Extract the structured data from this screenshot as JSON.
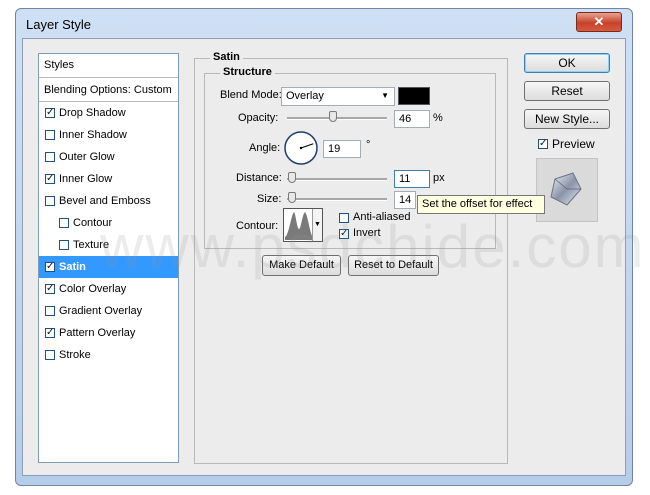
{
  "window": {
    "title": "Layer Style",
    "close_glyph": "✕"
  },
  "styles_panel": {
    "items": [
      {
        "label": "Styles",
        "checkbox": false,
        "checked": false
      },
      {
        "label": "Blending Options: Custom",
        "checkbox": false,
        "checked": false
      },
      {
        "label": "Drop Shadow",
        "checkbox": true,
        "checked": true
      },
      {
        "label": "Inner Shadow",
        "checkbox": true,
        "checked": false
      },
      {
        "label": "Outer Glow",
        "checkbox": true,
        "checked": false
      },
      {
        "label": "Inner Glow",
        "checkbox": true,
        "checked": true
      },
      {
        "label": "Bevel and Emboss",
        "checkbox": true,
        "checked": false
      },
      {
        "label": "Contour",
        "checkbox": true,
        "checked": false
      },
      {
        "label": "Texture",
        "checkbox": true,
        "checked": false
      },
      {
        "label": "Satin",
        "checkbox": true,
        "checked": true,
        "selected": true
      },
      {
        "label": "Color Overlay",
        "checkbox": true,
        "checked": true
      },
      {
        "label": "Gradient Overlay",
        "checkbox": true,
        "checked": false
      },
      {
        "label": "Pattern Overlay",
        "checkbox": true,
        "checked": true
      },
      {
        "label": "Stroke",
        "checkbox": true,
        "checked": false
      }
    ]
  },
  "satin": {
    "group_title": "Satin",
    "structure_title": "Structure",
    "blend_mode": {
      "label": "Blend Mode:",
      "value": "Overlay",
      "color": "#000000"
    },
    "opacity": {
      "label": "Opacity:",
      "value": "46",
      "unit": "%",
      "level": 0.46
    },
    "angle": {
      "label": "Angle:",
      "value": "19",
      "unit": "°"
    },
    "distance": {
      "label": "Distance:",
      "value": "11",
      "unit": "px",
      "level": 0.05
    },
    "size": {
      "label": "Size:",
      "value": "14",
      "level": 0.05
    },
    "contour": {
      "label": "Contour:"
    },
    "anti_aliased": {
      "label": "Anti-aliased",
      "checked": false
    },
    "invert": {
      "label": "Invert",
      "checked": true
    },
    "make_default": "Make Default",
    "reset_default": "Reset to Default"
  },
  "tooltip": "Set the offset for effect",
  "buttons": {
    "ok": "OK",
    "reset": "Reset",
    "new_style": "New Style...",
    "preview": "Preview",
    "preview_checked": true
  },
  "watermark": "www.psdchide.com"
}
